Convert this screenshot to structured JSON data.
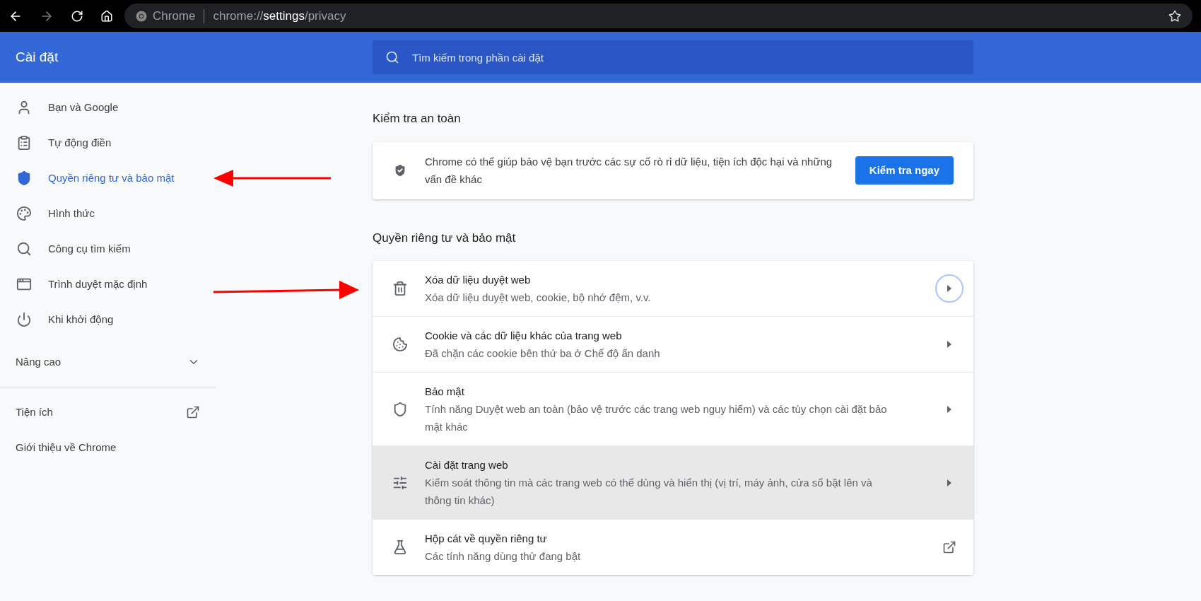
{
  "browser": {
    "site_name": "Chrome",
    "url_prefix": "chrome://",
    "url_host": "settings",
    "url_path": "/privacy"
  },
  "header": {
    "title": "Cài đặt",
    "search": {
      "placeholder": "Tìm kiếm trong phần cài đặt"
    }
  },
  "sidebar": {
    "items": [
      {
        "label": "Bạn và Google",
        "selected": false
      },
      {
        "label": "Tự động điền",
        "selected": false
      },
      {
        "label": "Quyền riêng tư và bảo mật",
        "selected": true
      },
      {
        "label": "Hình thức",
        "selected": false
      },
      {
        "label": "Công cụ tìm kiếm",
        "selected": false
      },
      {
        "label": "Trình duyệt mặc định",
        "selected": false
      },
      {
        "label": "Khi khởi động",
        "selected": false
      }
    ],
    "advanced": {
      "label": "Nâng cao",
      "expanded": false
    },
    "links": [
      {
        "label": "Tiện ích",
        "external": true
      },
      {
        "label": "Giới thiệu về Chrome",
        "external": false
      }
    ]
  },
  "safety_check": {
    "heading": "Kiểm tra an toàn",
    "text": "Chrome có thể giúp bảo vệ bạn trước các sự cố rò rỉ dữ liệu, tiện ích độc hại và những vấn đề khác",
    "button": "Kiểm tra ngay"
  },
  "privacy": {
    "heading": "Quyền riêng tư và bảo mật",
    "rows": [
      {
        "title": "Xóa dữ liệu duyệt web",
        "subtitle": "Xóa dữ liệu duyệt web, cookie, bộ nhớ đệm, v.v.",
        "kind": "arrow",
        "focused": true,
        "highlighted": false
      },
      {
        "title": "Cookie và các dữ liệu khác của trang web",
        "subtitle": "Đã chặn các cookie bên thứ ba ở Chế độ ẩn danh",
        "kind": "arrow",
        "focused": false,
        "highlighted": false
      },
      {
        "title": "Bảo mật",
        "subtitle": "Tính năng Duyệt web an toàn (bảo vệ trước các trang web nguy hiểm) và các tùy chọn cài đặt bảo mật khác",
        "kind": "arrow",
        "focused": false,
        "highlighted": false
      },
      {
        "title": "Cài đặt trang web",
        "subtitle": "Kiểm soát thông tin mà các trang web có thể dùng và hiển thị (vị trí, máy ảnh, cửa sổ bật lên và thông tin khác)",
        "kind": "arrow",
        "focused": false,
        "highlighted": true
      },
      {
        "title": "Hộp cát về quyền riêng tư",
        "subtitle": "Các tính năng dùng thử đang bật",
        "kind": "external",
        "focused": false,
        "highlighted": false
      }
    ]
  }
}
